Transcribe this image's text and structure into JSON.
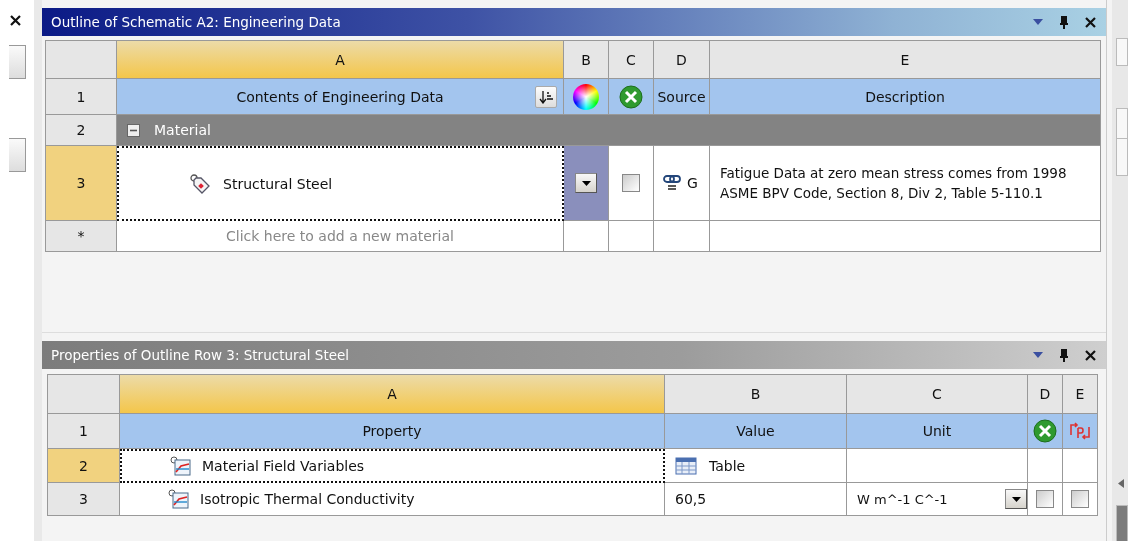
{
  "outline": {
    "title": "Outline of Schematic A2: Engineering Data",
    "column_letters": [
      "A",
      "B",
      "C",
      "D",
      "E"
    ],
    "header": {
      "number": "1",
      "contents": "Contents of Engineering Data",
      "source": "Source",
      "description": "Description"
    },
    "group": {
      "number": "2",
      "label": "Material",
      "expanded": true
    },
    "rows": [
      {
        "number": "3",
        "name": "Structural Steel",
        "selected": true,
        "checked": false,
        "source": "G",
        "description": "Fatigue Data at zero mean stress comes from 1998 ASME BPV Code, Section 8, Div 2, Table 5-110.1"
      }
    ],
    "new_row": {
      "number": "*",
      "placeholder": "Click here to add a new material"
    }
  },
  "properties": {
    "title": "Properties of Outline Row 3: Structural Steel",
    "column_letters": [
      "A",
      "B",
      "C",
      "D",
      "E"
    ],
    "header": {
      "number": "1",
      "property": "Property",
      "value": "Value",
      "unit": "Unit"
    },
    "rows": [
      {
        "number": "2",
        "kind": "table",
        "property": "Material Field Variables",
        "value": "Table",
        "selected": true
      },
      {
        "number": "3",
        "kind": "value",
        "property": "Isotropic Thermal Conductivity",
        "value": "60,5",
        "unit": "W m^-1 C^-1",
        "selected": false,
        "checked_d": false,
        "checked_e": false
      }
    ]
  }
}
